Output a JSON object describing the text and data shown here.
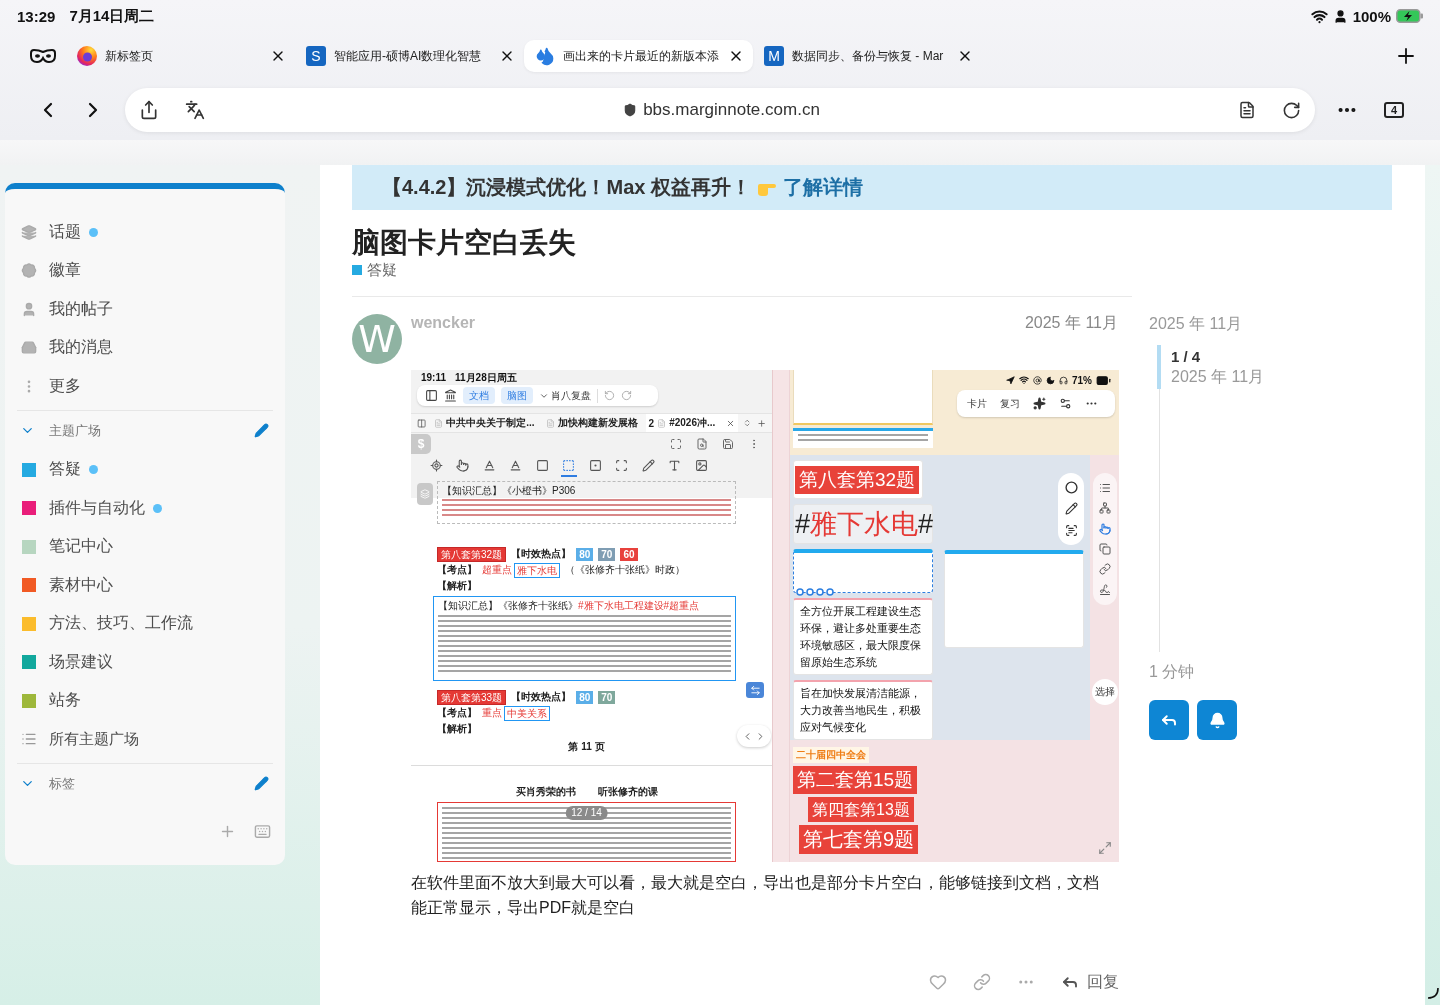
{
  "status_bar": {
    "time": "13:29",
    "date": "7月14日周二",
    "battery": "100%"
  },
  "browser": {
    "tabs": [
      {
        "kind": "browser",
        "title": "新标签页",
        "selected": false
      },
      {
        "kind": "letter",
        "letter": "S",
        "title": "智能应用-硕博AI数理化智慧",
        "selected": false
      },
      {
        "kind": "site",
        "title": "画出来的卡片最近的新版本添",
        "selected": true
      },
      {
        "kind": "letter",
        "letter": "M",
        "title": "数据同步、备份与恢复 - Mar",
        "selected": false
      }
    ],
    "url": "bbs.marginnote.com.cn",
    "tab_count": "4"
  },
  "sidebar": {
    "items": [
      {
        "label": "话题",
        "unread": true
      },
      {
        "label": "徽章",
        "unread": false
      },
      {
        "label": "我的帖子",
        "unread": false
      },
      {
        "label": "我的消息",
        "unread": false
      },
      {
        "label": "更多",
        "unread": false
      }
    ],
    "categories_header": {
      "label": "主题广场",
      "expanded": true
    },
    "categories": [
      {
        "label": "答疑",
        "color": "#25aae1",
        "unread": true
      },
      {
        "label": "插件与自动化",
        "color": "#e91e7a",
        "unread": true
      },
      {
        "label": "笔记中心",
        "color": "#b7d6c0",
        "unread": false
      },
      {
        "label": "素材中心",
        "color": "#f15a24",
        "unread": false
      },
      {
        "label": "方法、技巧、工作流",
        "color": "#fbbc2c",
        "unread": false
      },
      {
        "label": "场景建议",
        "color": "#12a89d",
        "unread": false
      },
      {
        "label": "站务",
        "color": "#9eb83b",
        "unread": false
      }
    ],
    "all_categories": "所有主题广场",
    "tags_header": {
      "label": "标签",
      "expanded": true
    }
  },
  "banner": {
    "text": "【4.4.2】沉浸模式优化！Max 权益再升！",
    "link": "了解详情"
  },
  "topic": {
    "title": "脑图卡片空白丢失",
    "category": {
      "label": "答疑",
      "color": "#25aae1"
    }
  },
  "post": {
    "author": "wencker",
    "avatar_letter": "W",
    "date": "2025 年 11月",
    "attachment": {
      "document": {
        "time": "19:11",
        "date": "11月28日周五",
        "modes": [
          "文档",
          "脑图"
        ],
        "notebook": "肖八复盘",
        "tabs": [
          {
            "title": "中共中央关于制定...",
            "selected": false
          },
          {
            "title": "加快构建新发展格",
            "selected": false
          },
          {
            "badge": "2",
            "title": "#2026冲...",
            "selected": true
          }
        ],
        "side_tab": "$",
        "tools": [
          {
            "selected": false
          },
          {
            "selected": false
          },
          {
            "selected": false
          },
          {
            "selected": false
          },
          {
            "selected": false
          },
          {
            "selected": true
          },
          {
            "selected": false
          },
          {
            "selected": false
          },
          {
            "selected": false
          },
          {
            "selected": false
          },
          {
            "selected": false
          }
        ],
        "summary_heading": "【知识汇总】《小橙书》P306",
        "questions": [
          {
            "tag": "第八套第32题",
            "hot": "【时效热点】",
            "scores": [
              {
                "value": "80",
                "color": "#5aaee8"
              },
              {
                "value": "70",
                "color": "#7f9db3"
              },
              {
                "value": "60",
                "color": "#e8413c"
              }
            ],
            "point_label": "【考点】",
            "importance": "超重点",
            "topic": "雅下水电",
            "source": "（《张修齐十张纸》时政）",
            "analysis": "【解析】",
            "excerpt": {
              "heading": "【知识汇总】《张修齐十张纸》",
              "heading_tag": "#雅下水电工程建设#超重点"
            }
          },
          {
            "tag": "第八套第33题",
            "hot": "【时效热点】",
            "scores": [
              {
                "value": "80",
                "color": "#5aaee8"
              },
              {
                "value": "70",
                "color": "#7fa89c"
              }
            ],
            "point_label": "【考点】",
            "importance": "重点",
            "topic": "中美关系",
            "analysis": "【解析】"
          }
        ],
        "page_label": "第 11 页",
        "next_page_header": [
          "买肖秀荣的书",
          "听张修齐的课"
        ],
        "page_counter": "12 / 14"
      },
      "mindmap": {
        "battery": "71%",
        "toolbar": [
          "卡片",
          "复习"
        ],
        "nodes": [
          {
            "kind": "tag",
            "text": "第八套第32题",
            "selected": false
          },
          {
            "kind": "hashtag",
            "prefix": "#",
            "text": "雅下水电",
            "suffix": "#",
            "selected": false
          },
          {
            "kind": "empty",
            "selected": true
          },
          {
            "kind": "note",
            "text": "全方位开展工程建设生态环保，避让多处重要生态环境敏感区，最大限度保留原始生态系统",
            "selected": false
          },
          {
            "kind": "note",
            "text": "旨在加快发展清洁能源，大力改善当地民生，积极应对气候变化",
            "selected": false
          }
        ],
        "side_nodes": [
          {
            "kind": "empty",
            "selected": false
          }
        ],
        "bottom_nodes": [
          {
            "kind": "chip",
            "text": "二十届四中全会",
            "selected": false
          },
          {
            "kind": "tag",
            "text": "第二套第15题",
            "selected": false
          },
          {
            "kind": "tag",
            "text": "第四套第13题",
            "selected": false
          },
          {
            "kind": "tag",
            "text": "第七套第9题",
            "selected": false
          }
        ],
        "select_label": "选择"
      }
    },
    "body": "在软件里面不放大到最大可以看，最大就是空白，导出也是部分卡片空白，能够链接到文档，文档能正常显示，导出PDF就是空白",
    "liked": false,
    "reply_label": "回复"
  },
  "timeline": {
    "start": "2025 年 11月",
    "position": "1 / 4",
    "position_date": "2025 年 11月",
    "end": "1 分钟"
  }
}
